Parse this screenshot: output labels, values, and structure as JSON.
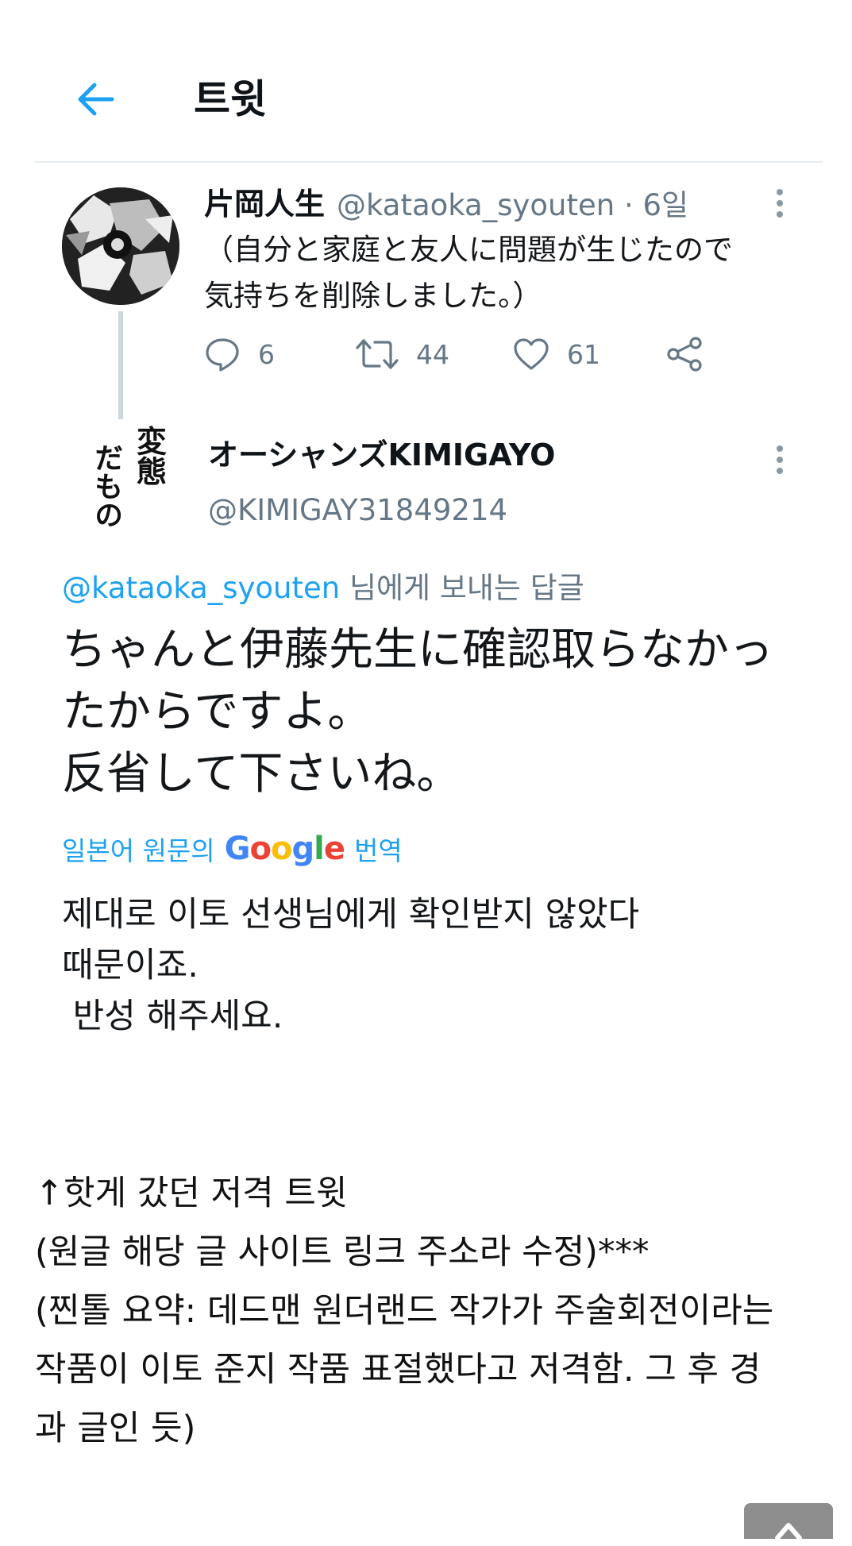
{
  "header": {
    "title": "트윗",
    "back_icon": "arrow-left-icon",
    "accent_color": "#1da1f2"
  },
  "tweet1": {
    "name": "片岡人生",
    "handle": "@kataoka_syouten",
    "time": "· 6일",
    "text_line1": "（自分と家庭と友人に問題が生じたので",
    "text_line2": "気持ちを削除しました。）",
    "reply_count": "6",
    "retweet_count": "44",
    "like_count": "61"
  },
  "tweet2": {
    "name": "オーシャンズKIMIGAYO",
    "handle": "@KIMIGAY31849214",
    "avatar_text": [
      "変態",
      "だもの"
    ],
    "reply_mention": "@kataoka_syouten",
    "reply_suffix": " 님에게 보내는 답글",
    "text_line1": "ちゃんと伊藤先生に確認取らなかっ",
    "text_line2": "たからですよ。",
    "text_line3": "反省して下さいね。",
    "translate_prefix": "일본어 원문의",
    "translate_brand": "Google",
    "translate_suffix": "번역",
    "translation_line1": "제대로 이토 선생님에게 확인받지 않았다",
    "translation_line2": "때문이죠.",
    "translation_line3": " 반성 해주세요."
  },
  "caption": {
    "line1": "↑핫게 갔던 저격 트윗",
    "line2": "(원글 해당 글 사이트 링크 주소라 수정)***",
    "line3": "(찐톨 요약: 데드맨 원더랜드 작가가 주술회전이라는",
    "line4": "작품이 이토 준지 작품 표절했다고 저격함. 그 후 경",
    "line5": "과 글인 듯)"
  }
}
